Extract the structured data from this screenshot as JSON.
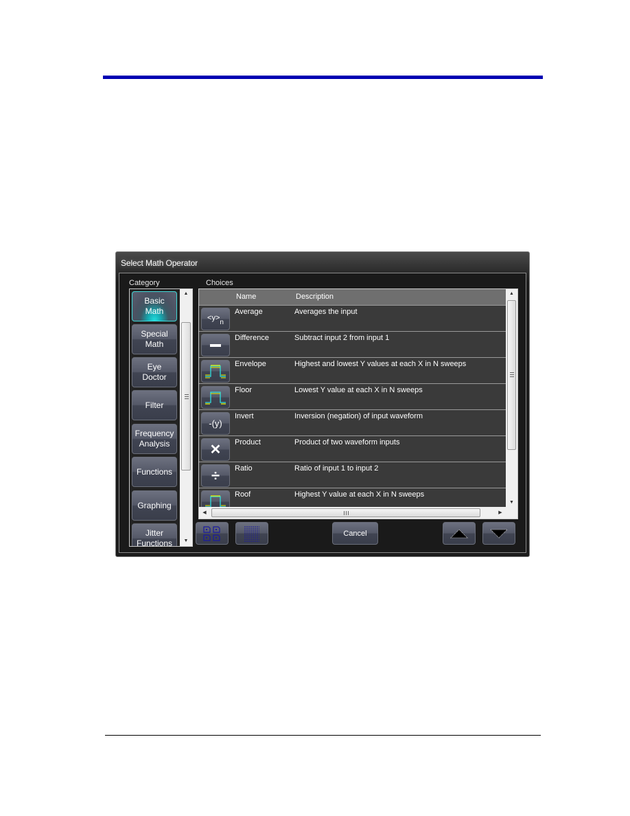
{
  "window": {
    "title": "Select Math Operator"
  },
  "labels": {
    "category": "Category",
    "choices": "Choices"
  },
  "categories": [
    {
      "label": "Basic\nMath",
      "active": true
    },
    {
      "label": "Special\nMath",
      "active": false
    },
    {
      "label": "Eye\nDoctor",
      "active": false
    },
    {
      "label": "Filter",
      "active": false
    },
    {
      "label": "Frequency\nAnalysis",
      "active": false
    },
    {
      "label": "Functions",
      "active": false
    },
    {
      "label": "Graphing",
      "active": false
    },
    {
      "label": "Jitter\nFunctions",
      "active": false
    }
  ],
  "table": {
    "columns": {
      "name": "Name",
      "description": "Description"
    },
    "rows": [
      {
        "icon": "average-icon",
        "name": "Average",
        "description": "Averages the input"
      },
      {
        "icon": "minus-icon",
        "name": "Difference",
        "description": "Subtract input 2 from input 1"
      },
      {
        "icon": "envelope-waveform-icon",
        "name": "Envelope",
        "description": "Highest and lowest Y values at each X in N sweeps"
      },
      {
        "icon": "floor-waveform-icon",
        "name": "Floor",
        "description": "Lowest Y value at each X in N sweeps"
      },
      {
        "icon": "invert-icon",
        "name": "Invert",
        "description": "Inversion (negation) of input waveform"
      },
      {
        "icon": "multiply-icon",
        "name": "Product",
        "description": "Product of two waveform inputs"
      },
      {
        "icon": "divide-icon",
        "name": "Ratio",
        "description": "Ratio of input 1 to input 2"
      },
      {
        "icon": "roof-waveform-icon",
        "name": "Roof",
        "description": "Highest Y value at each X in N sweeps"
      }
    ]
  },
  "icons": {
    "average_text": "<y>",
    "average_sub": "n",
    "invert_text": "-(y)",
    "multiply_glyph": "✕",
    "divide_glyph": "÷"
  },
  "buttons": {
    "cancel": "Cancel"
  },
  "colors": {
    "accent_cyan": "#22e0e0",
    "rule_blue": "#0000b3",
    "wave_yellow": "#e8f000",
    "wave_cyan": "#2fe0e0"
  }
}
